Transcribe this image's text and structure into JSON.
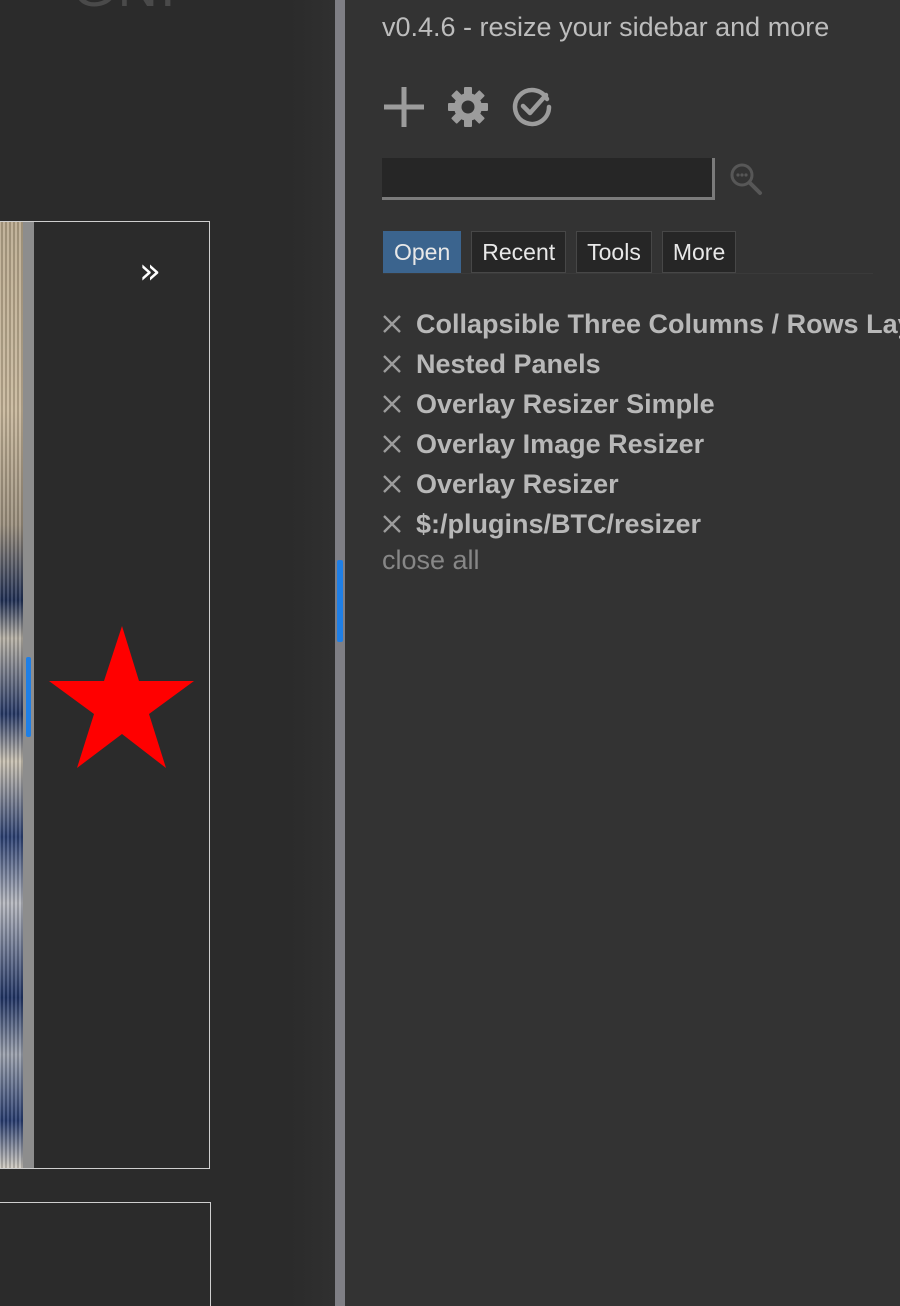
{
  "story": {
    "title_fragment": "GNI",
    "toggle_label": "»"
  },
  "sidebar": {
    "subtitle": "v0.4.6 - resize your sidebar and more",
    "toolbar": {
      "new_icon": "plus-icon",
      "settings_icon": "gear-icon",
      "done_icon": "check-circle-icon"
    },
    "search": {
      "value": "",
      "placeholder": ""
    },
    "tabs": [
      {
        "label": "Open",
        "active": true
      },
      {
        "label": "Recent",
        "active": false
      },
      {
        "label": "Tools",
        "active": false
      },
      {
        "label": "More",
        "active": false
      }
    ],
    "open_items": [
      {
        "label": "Collapsible Three Columns / Rows Layout"
      },
      {
        "label": "Nested Panels"
      },
      {
        "label": "Overlay Resizer Simple"
      },
      {
        "label": "Overlay Image Resizer"
      },
      {
        "label": "Overlay Resizer"
      },
      {
        "label": "$:/plugins/BTC/resizer"
      }
    ],
    "close_all_label": "close all"
  },
  "colors": {
    "accent": "#1f7fe6",
    "active_tab": "#3b648e",
    "star": "#ff0000",
    "sidebar_bg": "#333333"
  }
}
